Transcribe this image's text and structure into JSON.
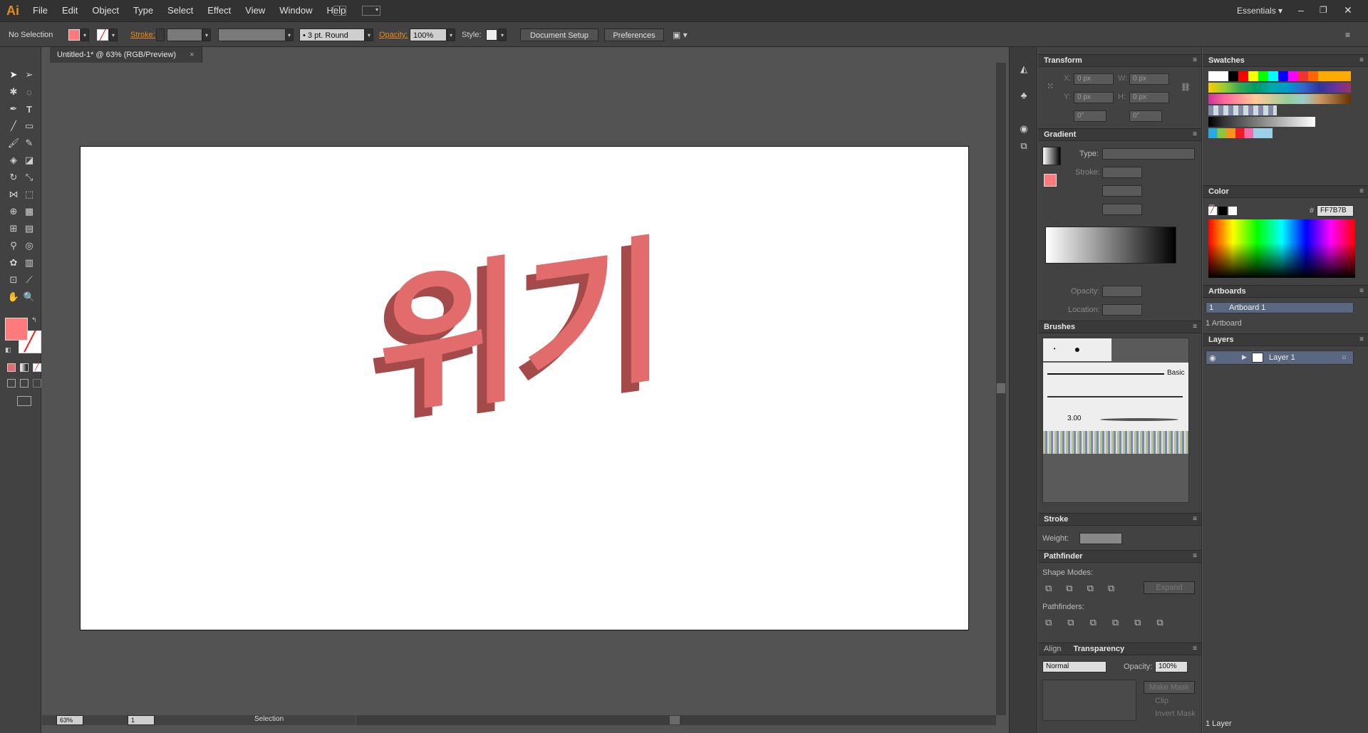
{
  "app": {
    "logo": "Ai",
    "workspace": "Essentials"
  },
  "menu": [
    "File",
    "Edit",
    "Object",
    "Type",
    "Select",
    "Effect",
    "View",
    "Window",
    "Help"
  ],
  "control": {
    "selection": "No Selection",
    "stroke_label": "Stroke:",
    "brush": "3 pt. Round",
    "opacity_label": "Opacity:",
    "opacity": "100%",
    "style_label": "Style:",
    "doc_setup": "Document Setup",
    "preferences": "Preferences"
  },
  "document": {
    "tab": "Untitled-1* @ 63% (RGB/Preview)",
    "art_text": "위기",
    "art_color": "#E26B6B",
    "art_shadow": "#A54A4A"
  },
  "status": {
    "zoom": "63%",
    "page": "1",
    "tool": "Selection"
  },
  "transform": {
    "title": "Transform",
    "x_label": "X:",
    "x": "0 px",
    "y_label": "Y:",
    "y": "0 px",
    "w_label": "W:",
    "w": "0 px",
    "h_label": "H:",
    "h": "0 px",
    "rot": "0°",
    "shear": "0°"
  },
  "gradient": {
    "title": "Gradient",
    "type_label": "Type:",
    "stroke_label": "Stroke:",
    "opacity_label": "Opacity:",
    "location_label": "Location:"
  },
  "brushes": {
    "title": "Brushes",
    "basic": "Basic",
    "size": "3.00"
  },
  "stroke": {
    "title": "Stroke",
    "weight_label": "Weight:"
  },
  "pathfinder": {
    "title": "Pathfinder",
    "shape_modes": "Shape Modes:",
    "pathfinders": "Pathfinders:",
    "expand": "Expand"
  },
  "transparency": {
    "align_tab": "Align",
    "title": "Transparency",
    "mode": "Normal",
    "opacity_label": "Opacity:",
    "opacity": "100%",
    "make_mask": "Make Mask",
    "clip": "Clip",
    "invert": "Invert Mask"
  },
  "swatches": {
    "title": "Swatches"
  },
  "color": {
    "title": "Color",
    "hex_label": "#",
    "hex": "FF7B7B",
    "fill": "#FF7B7B"
  },
  "artboards": {
    "title": "Artboards",
    "items": [
      {
        "num": "1",
        "name": "Artboard 1"
      }
    ],
    "count": "1 Artboard"
  },
  "layers": {
    "title": "Layers",
    "items": [
      {
        "name": "Layer 1"
      }
    ],
    "count": "1 Layer"
  }
}
